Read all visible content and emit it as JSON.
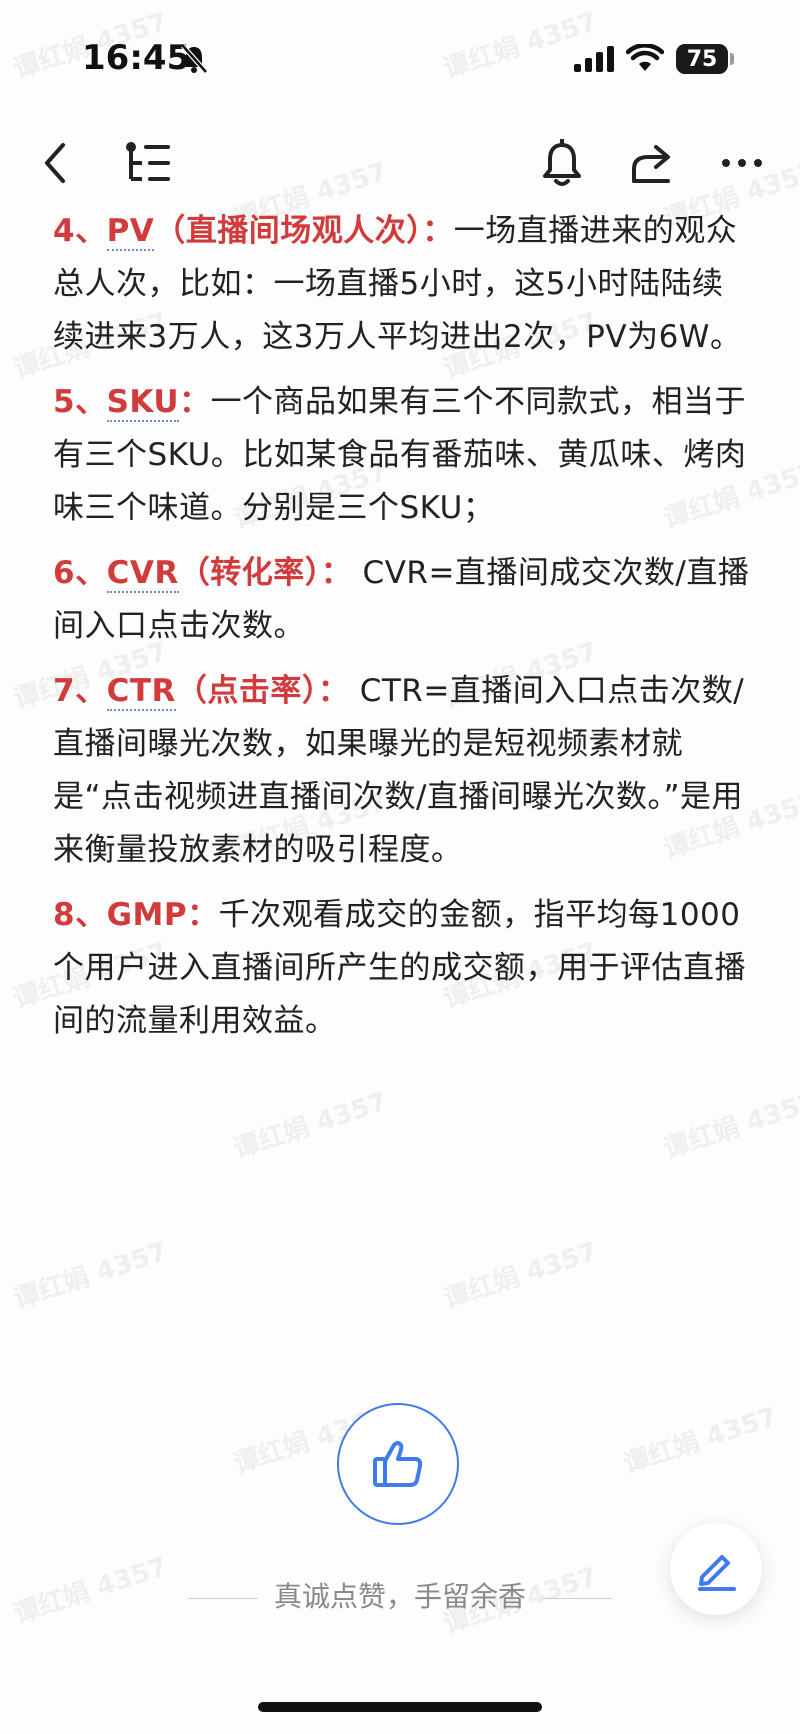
{
  "status_bar": {
    "time": "16:45",
    "battery": "75"
  },
  "watermark": "谭红娟 4357",
  "nav": {
    "back_icon": "chevron-left-icon",
    "outline_icon": "outline-list-icon",
    "bell_icon": "bell-icon",
    "share_icon": "share-icon",
    "more_icon": "more-dots-icon"
  },
  "paragraphs": [
    {
      "num": "4、",
      "term": "PV",
      "extra": "（直播间场观人次）",
      "colon": "：",
      "body": "一场直播进来的观众总人次，比如：一场直播5小时，这5小时陆陆续续进来3万人，这3万人平均进出2次，PV为6W。"
    },
    {
      "num": "5、",
      "term": "SKU",
      "extra": "",
      "colon": "：",
      "body": "一个商品如果有三个不同款式，相当于有三个SKU。比如某食品有番茄味、黄瓜味、烤肉味三个味道。分别是三个SKU；"
    },
    {
      "num": "6、",
      "term": "CVR",
      "extra": "（转化率）",
      "colon": "：",
      "body": " CVR=直播间成交次数/直播间入口点击次数。"
    },
    {
      "num": "7、",
      "term": "CTR",
      "extra": "（点击率）",
      "colon": "：",
      "body": " CTR=直播间入口点击次数/直播间曝光次数，如果曝光的是短视频素材就是“点击视频进直播间次数/直播间曝光次数。”是用来衡量投放素材的吸引程度。"
    },
    {
      "num": "8、",
      "term": "GMP",
      "extra": "",
      "colon": "：",
      "body": "千次观看成交的金额，指平均每1000个用户进入直播间所产生的成交额，用于评估直播间的流量利用效益。"
    }
  ],
  "like": {
    "caption": "真诚点赞，手留余香",
    "icon": "thumbs-up-icon"
  },
  "fab": {
    "icon": "edit-pencil-icon"
  },
  "colors": {
    "accent_red": "#d23b3b",
    "like_blue": "#3d7bef"
  }
}
